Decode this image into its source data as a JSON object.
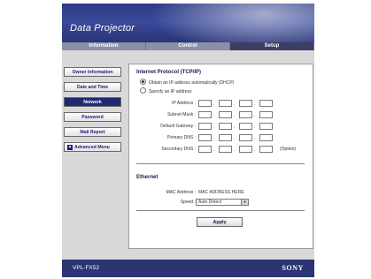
{
  "header": {
    "title": "Data Projector"
  },
  "tabs": [
    {
      "label": "Information"
    },
    {
      "label": "Control"
    },
    {
      "label": "Setup"
    }
  ],
  "sidebar": {
    "items": [
      {
        "label": "Owner Information"
      },
      {
        "label": "Date and Time"
      },
      {
        "label": "Network"
      },
      {
        "label": "Password"
      },
      {
        "label": "Mail Report"
      },
      {
        "label": "Advanced Menu"
      }
    ]
  },
  "tcpip": {
    "title": "Internet Protocol (TCP/IP)",
    "option_auto": "Obtain an IP address automatically (DHCP)",
    "option_manual": "Specify an IP address",
    "selected": "auto",
    "fields": [
      {
        "label": "IP Address :"
      },
      {
        "label": "Subnet Mask :"
      },
      {
        "label": "Default Gateway :"
      },
      {
        "label": "Primary DNS :"
      },
      {
        "label": "Secondary DNS :"
      }
    ],
    "option_note": "(Option)"
  },
  "ethernet": {
    "title": "Ethernet",
    "mac_label": "MAC Address :",
    "mac_value": "MAC ADDRESS HERE",
    "speed_label": "Speed :",
    "speed_value": "Auto Detect"
  },
  "apply_label": "Apply",
  "footer": {
    "model": "VPL-FX52",
    "brand": "SONY"
  }
}
